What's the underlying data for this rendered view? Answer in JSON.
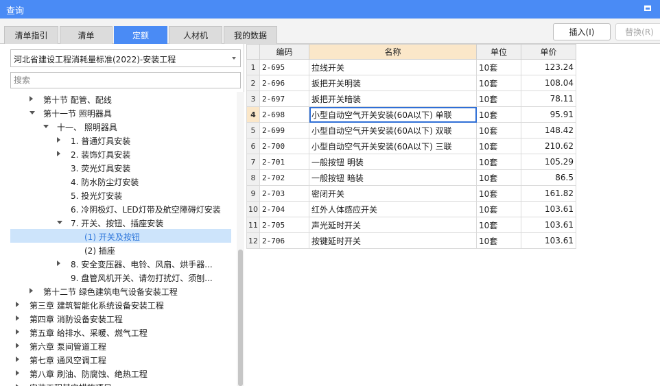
{
  "window": {
    "title": "查询"
  },
  "tabs": [
    {
      "label": "清单指引",
      "active": false
    },
    {
      "label": "清单",
      "active": false
    },
    {
      "label": "定额",
      "active": true
    },
    {
      "label": "人材机",
      "active": false
    },
    {
      "label": "我的数据",
      "active": false
    }
  ],
  "buttons": {
    "insert": "插入(I)",
    "replace": "替换(R)"
  },
  "library_select": {
    "value": "河北省建设工程消耗量标准(2022)-安装工程"
  },
  "search": {
    "placeholder": "搜索",
    "value": ""
  },
  "tree": [
    {
      "label": "第十节 配管、配线",
      "level": 2,
      "toggle": "closed"
    },
    {
      "label": "第十一节 照明器具",
      "level": 2,
      "toggle": "open"
    },
    {
      "label": "十一、 照明器具",
      "level": 3,
      "toggle": "open"
    },
    {
      "label": "1. 普通灯具安装",
      "level": 4,
      "toggle": "closed"
    },
    {
      "label": "2. 装饰灯具安装",
      "level": 4,
      "toggle": "closed"
    },
    {
      "label": "3. 荧光灯具安装",
      "level": 4,
      "toggle": "none"
    },
    {
      "label": "4. 防水防尘灯安装",
      "level": 4,
      "toggle": "none"
    },
    {
      "label": "5. 投光灯安装",
      "level": 4,
      "toggle": "none"
    },
    {
      "label": "6. 冷阴极灯、LED灯带及航空障碍灯安装",
      "level": 4,
      "toggle": "none"
    },
    {
      "label": "7. 开关、按钮、插座安装",
      "level": 4,
      "toggle": "open"
    },
    {
      "label": "(1) 开关及按钮",
      "level": 5,
      "toggle": "none",
      "selected": true
    },
    {
      "label": "(2) 插座",
      "level": 5,
      "toggle": "none"
    },
    {
      "label": "8. 安全变压器、电铃、风扇、烘手器...",
      "level": 4,
      "toggle": "closed"
    },
    {
      "label": "9. 盘管风机开关、请勿打扰灯、须刨...",
      "level": 4,
      "toggle": "none"
    },
    {
      "label": "第十二节 绿色建筑电气设备安装工程",
      "level": 2,
      "toggle": "closed"
    },
    {
      "label": "第三章 建筑智能化系统设备安装工程",
      "level": 1,
      "toggle": "closed"
    },
    {
      "label": "第四章 消防设备安装工程",
      "level": 1,
      "toggle": "closed"
    },
    {
      "label": "第五章 给排水、采暖、燃气工程",
      "level": 1,
      "toggle": "closed"
    },
    {
      "label": "第六章 泵间管道工程",
      "level": 1,
      "toggle": "closed"
    },
    {
      "label": "第七章 通风空调工程",
      "level": 1,
      "toggle": "closed"
    },
    {
      "label": "第八章 刷油、防腐蚀、绝热工程",
      "level": 1,
      "toggle": "closed"
    },
    {
      "label": "安装工程其它措施项目",
      "level": 1,
      "toggle": "closed"
    }
  ],
  "table": {
    "headers": {
      "code": "编码",
      "name": "名称",
      "unit": "单位",
      "price": "单价"
    },
    "current_row": 4,
    "rows": [
      {
        "no": "1",
        "code": "2-695",
        "name": "拉线开关",
        "unit": "10套",
        "price": "123.24"
      },
      {
        "no": "2",
        "code": "2-696",
        "name": "扳把开关明装",
        "unit": "10套",
        "price": "108.04"
      },
      {
        "no": "3",
        "code": "2-697",
        "name": "扳把开关暗装",
        "unit": "10套",
        "price": "78.11"
      },
      {
        "no": "4",
        "code": "2-698",
        "name": "小型自动空气开关安装(60A以下) 单联",
        "unit": "10套",
        "price": "95.91"
      },
      {
        "no": "5",
        "code": "2-699",
        "name": "小型自动空气开关安装(60A以下) 双联",
        "unit": "10套",
        "price": "148.42"
      },
      {
        "no": "6",
        "code": "2-700",
        "name": "小型自动空气开关安装(60A以下) 三联",
        "unit": "10套",
        "price": "210.62"
      },
      {
        "no": "7",
        "code": "2-701",
        "name": "一般按钮 明装",
        "unit": "10套",
        "price": "105.29"
      },
      {
        "no": "8",
        "code": "2-702",
        "name": "一般按钮 暗装",
        "unit": "10套",
        "price": "86.5"
      },
      {
        "no": "9",
        "code": "2-703",
        "name": "密闭开关",
        "unit": "10套",
        "price": "161.82"
      },
      {
        "no": "10",
        "code": "2-704",
        "name": "红外人体感应开关",
        "unit": "10套",
        "price": "103.61"
      },
      {
        "no": "11",
        "code": "2-705",
        "name": "声光延时开关",
        "unit": "10套",
        "price": "103.61"
      },
      {
        "no": "12",
        "code": "2-706",
        "name": "按键延时开关",
        "unit": "10套",
        "price": "103.61"
      }
    ]
  }
}
